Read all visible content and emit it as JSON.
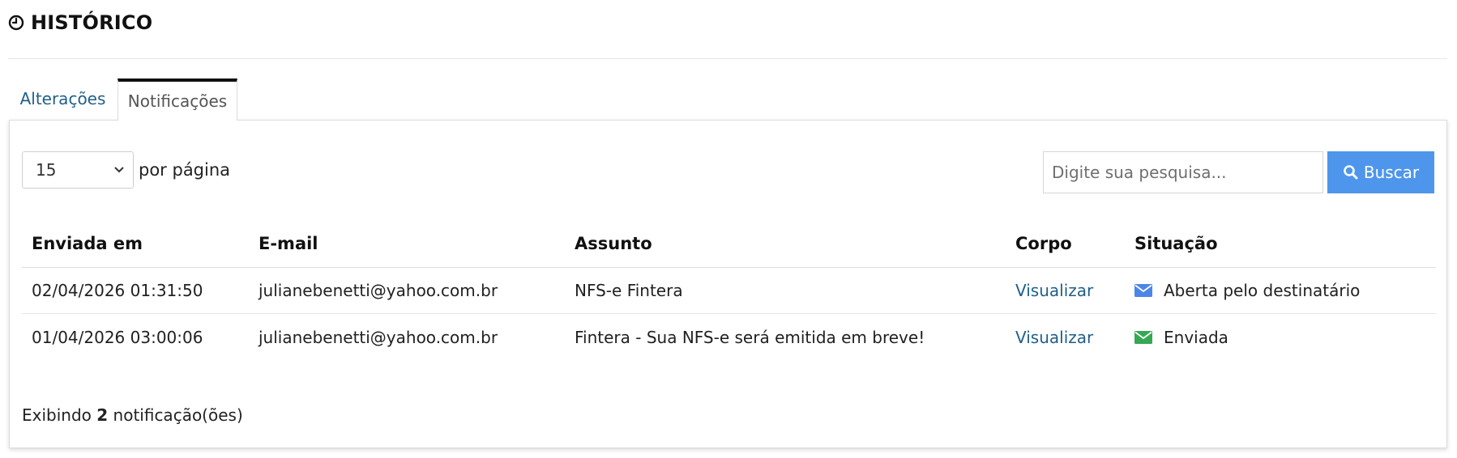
{
  "header": {
    "title": "HISTÓRICO",
    "icon": "clock-icon"
  },
  "tabs": [
    {
      "label": "Alterações",
      "active": false
    },
    {
      "label": "Notificações",
      "active": true
    }
  ],
  "controls": {
    "per_page_value": "15",
    "per_page_label": "por página",
    "search_placeholder": "Digite sua pesquisa...",
    "search_button": "Buscar"
  },
  "table": {
    "columns": [
      "Enviada em",
      "E-mail",
      "Assunto",
      "Corpo",
      "Situação"
    ],
    "rows": [
      {
        "sent_at": "02/04/2026 01:31:50",
        "email": "julianebenetti@yahoo.com.br",
        "subject": "NFS-e Fintera",
        "body_link": "Visualizar",
        "status": "Aberta pelo destinatário",
        "status_icon": "envelope-icon",
        "status_color": "#4a86e8"
      },
      {
        "sent_at": "01/04/2026 03:00:06",
        "email": "julianebenetti@yahoo.com.br",
        "subject": "Fintera - Sua NFS-e será emitida em breve!",
        "body_link": "Visualizar",
        "status": "Enviada",
        "status_icon": "envelope-icon",
        "status_color": "#34a853"
      }
    ]
  },
  "footer": {
    "prefix": "Exibindo",
    "count": "2",
    "suffix": "notificação(ões)"
  },
  "colors": {
    "accent": "#4d96ec",
    "link": "#1f5f8a"
  }
}
